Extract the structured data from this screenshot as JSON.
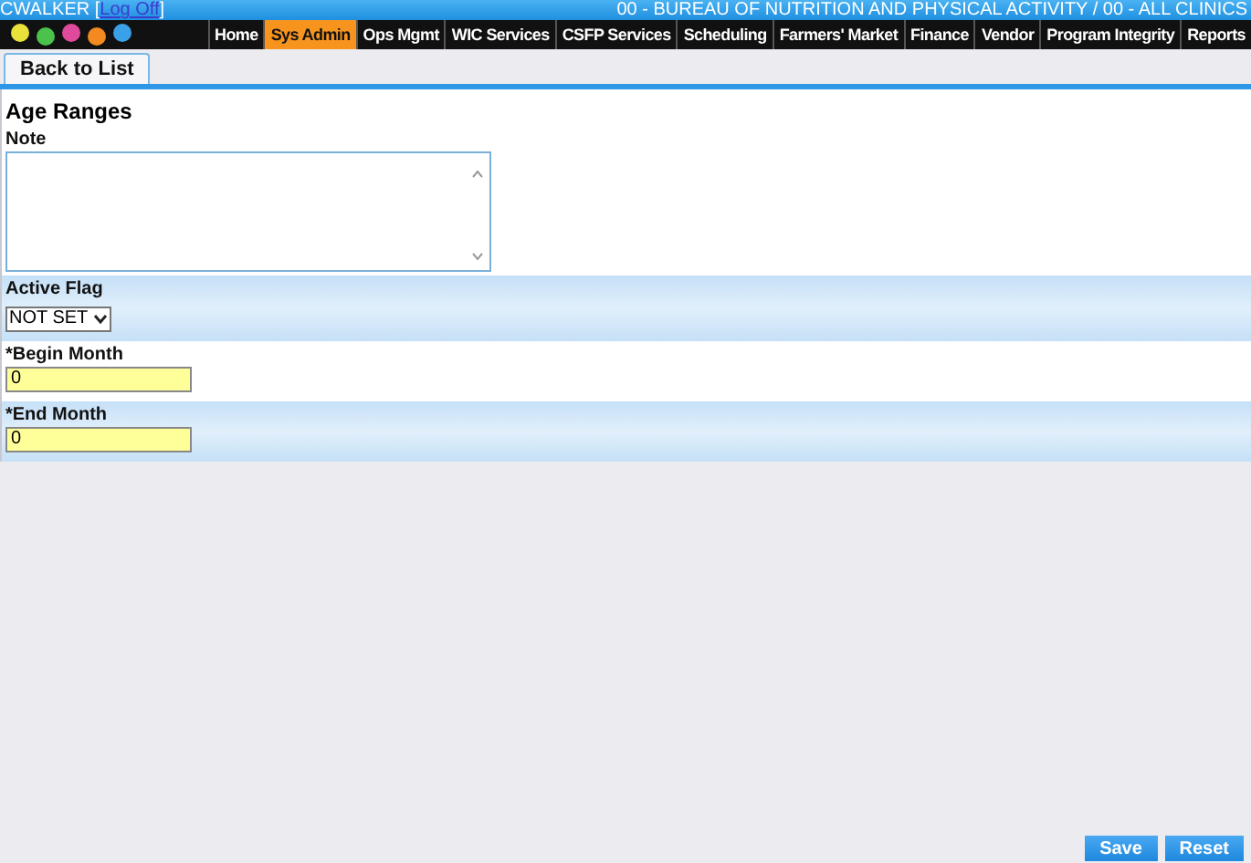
{
  "header": {
    "user": "CWALKER",
    "bracket_open": "[",
    "logoff": "Log Off",
    "bracket_close": "]",
    "location": "00 - BUREAU OF NUTRITION AND PHYSICAL ACTIVITY / 00 - ALL CLINICS"
  },
  "nav": [
    {
      "label": "Home",
      "selected": false
    },
    {
      "label": "Sys Admin",
      "selected": true
    },
    {
      "label": "Ops Mgmt",
      "selected": false
    },
    {
      "label": "WIC Services",
      "selected": false
    },
    {
      "label": "CSFP Services",
      "selected": false
    },
    {
      "label": "Scheduling",
      "selected": false
    },
    {
      "label": "Farmers' Market",
      "selected": false
    },
    {
      "label": "Finance",
      "selected": false
    },
    {
      "label": "Vendor",
      "selected": false
    },
    {
      "label": "Program Integrity",
      "selected": false
    },
    {
      "label": "Reports",
      "selected": false
    }
  ],
  "tabs": [
    "Back to List"
  ],
  "form": {
    "title": "Age Ranges",
    "fields": [
      {
        "kind": "textarea",
        "label": "Note"
      },
      {
        "kind": "select",
        "label": "Active Flag",
        "value": "NOT SET"
      },
      {
        "kind": "text",
        "label": "*Begin Month",
        "value": "0"
      },
      {
        "kind": "text",
        "label": "*End Month",
        "value": "0"
      }
    ]
  },
  "buttons": [
    "Save",
    "Reset"
  ]
}
